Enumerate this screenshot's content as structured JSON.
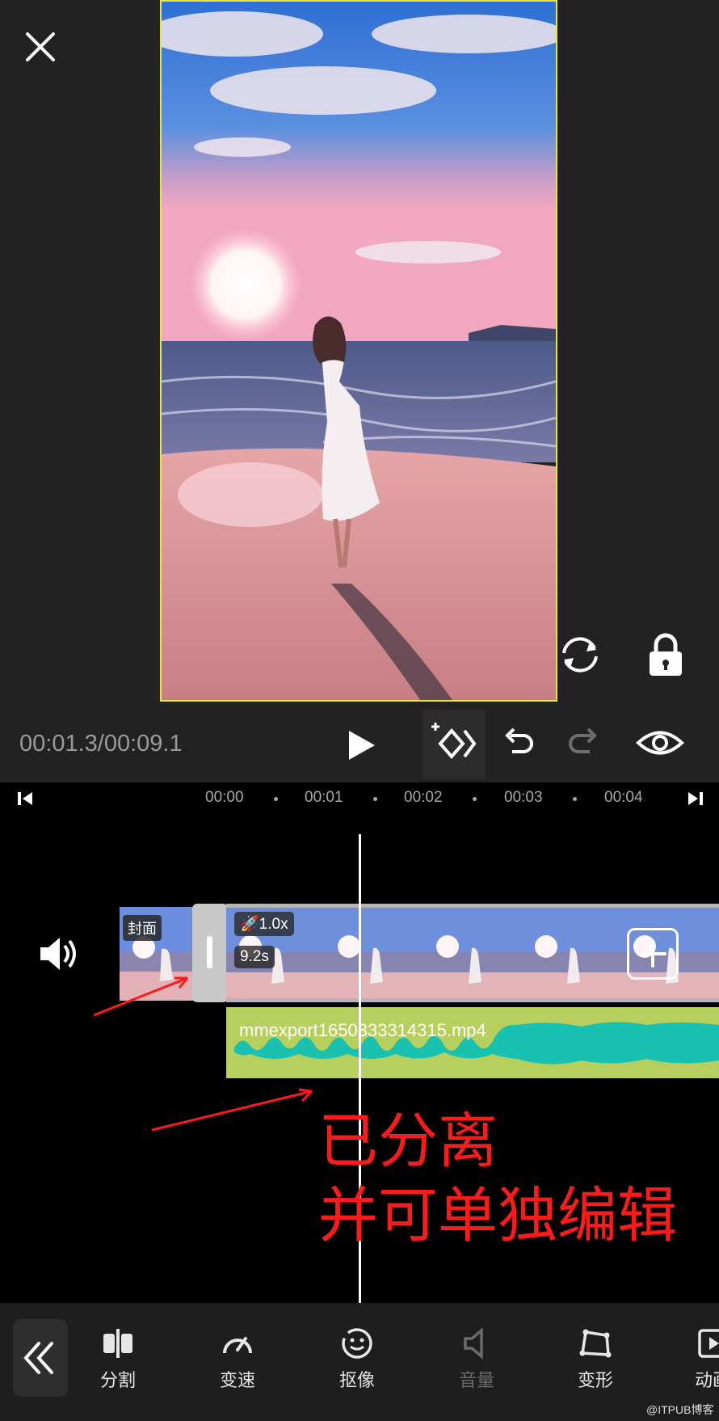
{
  "player": {
    "time": "00:01.3/00:09.1"
  },
  "timeline": {
    "ticks": [
      "00:00",
      "00:01",
      "00:02",
      "00:03",
      "00:04"
    ],
    "cover_label": "封面",
    "speed_badge": "1.0x",
    "duration_badge": "9.2s",
    "audio_filename": "mmexport1650333314315.mp4"
  },
  "annotation": {
    "line1": "已分离",
    "line2": "并可单独编辑"
  },
  "toolbar": {
    "items": [
      {
        "label": "分割",
        "icon": "split-icon",
        "enabled": true
      },
      {
        "label": "变速",
        "icon": "speed-gauge-icon",
        "enabled": true
      },
      {
        "label": "抠像",
        "icon": "face-cutout-icon",
        "enabled": true
      },
      {
        "label": "音量",
        "icon": "speaker-icon",
        "enabled": false
      },
      {
        "label": "变形",
        "icon": "transform-icon",
        "enabled": true
      },
      {
        "label": "动画",
        "icon": "animation-icon",
        "enabled": true
      }
    ]
  },
  "watermark": "@ITPUB博客",
  "colors": {
    "frame_border": "#e8e34a",
    "audio_track": "#b7d05d",
    "waveform": "#19c2b0",
    "annotation": "#ff1a1a"
  }
}
